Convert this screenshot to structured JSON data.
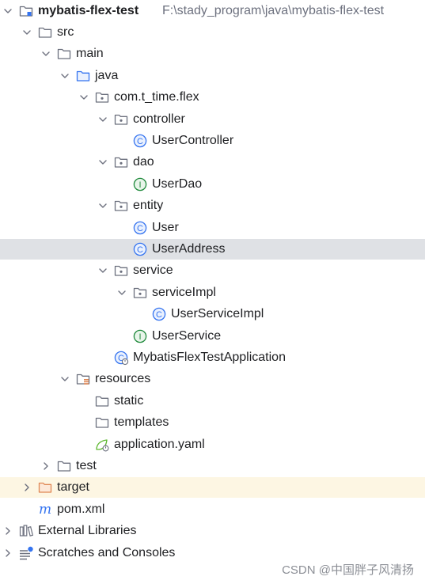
{
  "project": {
    "rows": [
      {
        "label": "mybatis-flex-test",
        "path": "F:\\stady_program\\java\\mybatis-flex-test",
        "icon": "module-folder-icon",
        "chevron": "chevron-down-icon",
        "depth": 0,
        "bold": true
      },
      {
        "label": "src",
        "icon": "folder-icon",
        "chevron": "chevron-down-icon",
        "depth": 1
      },
      {
        "label": "main",
        "icon": "folder-icon",
        "chevron": "chevron-down-icon",
        "depth": 2
      },
      {
        "label": "java",
        "icon": "source-root-folder-icon",
        "chevron": "chevron-down-icon",
        "depth": 3
      },
      {
        "label": "com.t_time.flex",
        "icon": "package-icon",
        "chevron": "chevron-down-icon",
        "depth": 4
      },
      {
        "label": "controller",
        "icon": "package-icon",
        "chevron": "chevron-down-icon",
        "depth": 5
      },
      {
        "label": "UserController",
        "icon": "class-icon",
        "chevron": "",
        "depth": 6
      },
      {
        "label": "dao",
        "icon": "package-icon",
        "chevron": "chevron-down-icon",
        "depth": 5
      },
      {
        "label": "UserDao",
        "icon": "interface-icon",
        "chevron": "",
        "depth": 6
      },
      {
        "label": "entity",
        "icon": "package-icon",
        "chevron": "chevron-down-icon",
        "depth": 5
      },
      {
        "label": "User",
        "icon": "class-icon",
        "chevron": "",
        "depth": 6
      },
      {
        "label": "UserAddress",
        "icon": "class-icon",
        "chevron": "",
        "depth": 6,
        "selected": true
      },
      {
        "label": "service",
        "icon": "package-icon",
        "chevron": "chevron-down-icon",
        "depth": 5
      },
      {
        "label": "serviceImpl",
        "icon": "package-icon",
        "chevron": "chevron-down-icon",
        "depth": 6
      },
      {
        "label": "UserServiceImpl",
        "icon": "class-icon",
        "chevron": "",
        "depth": 7
      },
      {
        "label": "UserService",
        "icon": "interface-icon",
        "chevron": "",
        "depth": 6
      },
      {
        "label": "MybatisFlexTestApplication",
        "icon": "spring-boot-class-icon",
        "chevron": "",
        "depth": 5
      },
      {
        "label": "resources",
        "icon": "resources-folder-icon",
        "chevron": "chevron-down-icon",
        "depth": 3
      },
      {
        "label": "static",
        "icon": "folder-icon",
        "chevron": "",
        "depth": 4
      },
      {
        "label": "templates",
        "icon": "folder-icon",
        "chevron": "",
        "depth": 4
      },
      {
        "label": "application.yaml",
        "icon": "spring-config-icon",
        "chevron": "",
        "depth": 4
      },
      {
        "label": "test",
        "icon": "folder-icon",
        "chevron": "chevron-right-icon",
        "depth": 2
      },
      {
        "label": "target",
        "icon": "excluded-folder-icon",
        "chevron": "chevron-right-icon",
        "depth": 1,
        "excluded": true
      },
      {
        "label": "pom.xml",
        "icon": "maven-icon",
        "chevron": "",
        "depth": 1
      },
      {
        "label": "External Libraries",
        "icon": "libraries-icon",
        "chevron": "chevron-right-icon",
        "depth": 0
      },
      {
        "label": "Scratches and Consoles",
        "icon": "scratches-icon",
        "chevron": "chevron-right-icon",
        "depth": 0
      }
    ]
  },
  "watermark": "CSDN @中国胖子风清扬",
  "colors": {
    "selection": "#dfe1e5",
    "excluded_row": "#fdf6e3",
    "text": "#1e1f22",
    "path_text": "#6c707e",
    "icon_gray": "#6c707e",
    "class_blue": "#3574f0",
    "interface_green": "#208a3c",
    "source_blue": "#3574f0",
    "excluded_orange": "#e08855",
    "resources_orange": "#e08855",
    "spring_green": "#5fb832",
    "chevron": "#6c707e"
  }
}
